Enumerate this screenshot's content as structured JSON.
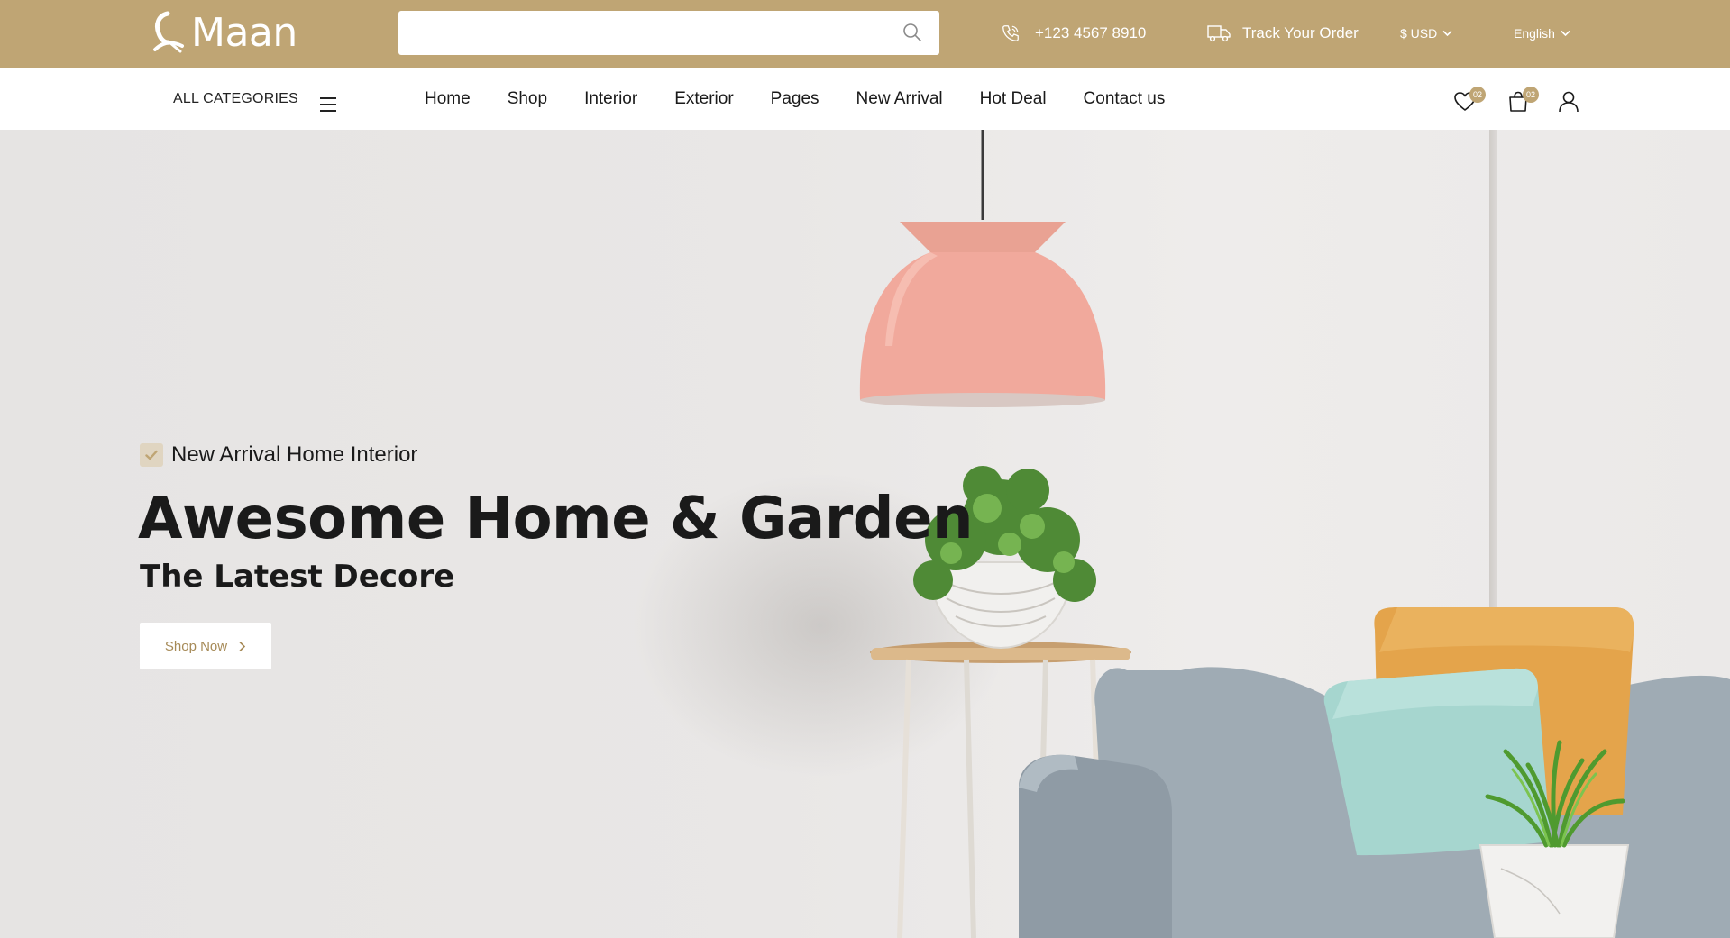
{
  "brand": {
    "name": "Maan",
    "accent": "#bfa574"
  },
  "topbar": {
    "search": {
      "placeholder": "",
      "icon": "search-icon"
    },
    "phone": {
      "icon": "phone-icon",
      "number": "+123 4567 8910"
    },
    "track": {
      "icon": "delivery-truck-icon",
      "label": "Track Your Order"
    },
    "currency": {
      "label": "$ USD"
    },
    "language": {
      "label": "English"
    }
  },
  "navbar": {
    "all_categories": "ALL CATEGORIES",
    "menu": [
      "Home",
      "Shop",
      "Interior",
      "Exterior",
      "Pages",
      "New Arrival",
      "Hot Deal",
      "Contact us"
    ],
    "wishlist": {
      "icon": "heart-icon",
      "count": "02"
    },
    "cart": {
      "icon": "shopping-bag-icon",
      "count": "02"
    },
    "account": {
      "icon": "user-icon"
    }
  },
  "hero": {
    "eyebrow": "New Arrival Home Interior",
    "title": "Awesome Home & Garden",
    "subtitle": "The Latest Decore",
    "cta": "Shop Now"
  }
}
